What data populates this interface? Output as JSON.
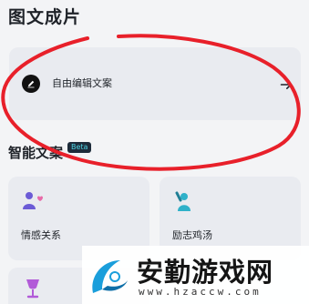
{
  "header": {
    "title": "图文成片"
  },
  "free_edit": {
    "label": "自由编辑文案",
    "icon": "pencil-icon",
    "arrow_icon": "arrow-right-icon"
  },
  "smart": {
    "title": "智能文案",
    "badge": "Beta"
  },
  "tiles": [
    {
      "label": "情感关系",
      "icon": "people-heart-icon"
    },
    {
      "label": "励志鸡汤",
      "icon": "cheering-person-icon"
    },
    {
      "label": "",
      "icon": "wine-glass-icon"
    }
  ],
  "annotation": {
    "color": "#e8202a"
  },
  "watermark": {
    "name": "安勤游戏网",
    "url": "www.hzaccw.com"
  }
}
